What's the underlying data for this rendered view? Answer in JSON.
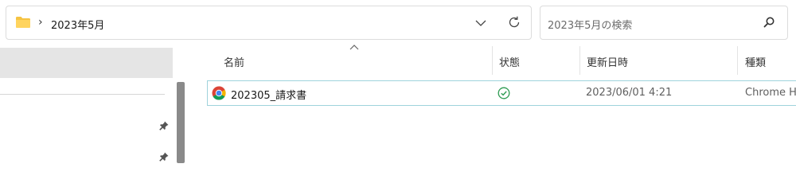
{
  "address_bar": {
    "path": "2023年5月",
    "separator": "›"
  },
  "search": {
    "placeholder": "2023年5月の検索"
  },
  "columns": {
    "name": "名前",
    "status": "状態",
    "modified": "更新日時",
    "type": "種類"
  },
  "files": [
    {
      "name": "202305_請求書",
      "status": "available-offline",
      "modified": "2023/06/01 4:21",
      "type": "Chrome H"
    }
  ],
  "colors": {
    "folder": "#f5c342",
    "status_ok": "#2e9b52",
    "selection_border": "#9fd3dc",
    "nav_selected": "#e5e5e5"
  },
  "icons": {
    "folder": "folder-icon",
    "breadcrumb_separator": "chevron-right-icon",
    "address_dropdown": "chevron-down-icon",
    "refresh": "refresh-icon",
    "search": "search-icon",
    "pin": "pin-icon",
    "file": "chrome-icon",
    "status": "check-circle-icon"
  }
}
